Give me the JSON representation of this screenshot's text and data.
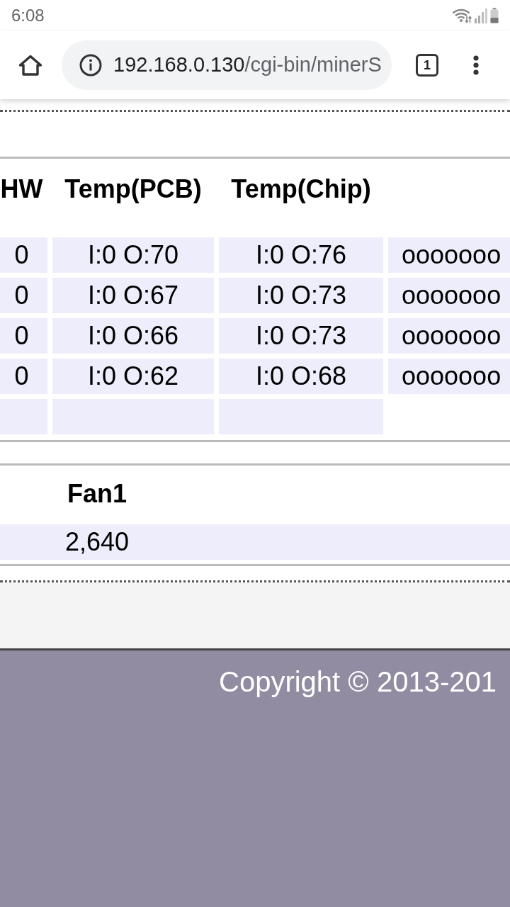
{
  "status_bar": {
    "time": "6:08"
  },
  "browser": {
    "url_host": "192.168.0.130",
    "url_path": "/cgi-bin/minerS",
    "tab_count": "1"
  },
  "stats_table": {
    "columns": [
      "HW",
      "Temp(PCB)",
      "Temp(Chip)"
    ],
    "rows": [
      {
        "kind": "data",
        "cells": [
          "0",
          "I:0 O:70",
          "I:0 O:76",
          "ooooooo"
        ]
      },
      {
        "kind": "data",
        "cells": [
          "0",
          "I:0 O:67",
          "I:0 O:73",
          "ooooooo"
        ]
      },
      {
        "kind": "data",
        "cells": [
          "0",
          "I:0 O:66",
          "I:0 O:73",
          "ooooooo"
        ]
      },
      {
        "kind": "data",
        "cells": [
          "0",
          "I:0 O:62",
          "I:0 O:68",
          "ooooooo"
        ]
      },
      {
        "kind": "blank"
      }
    ]
  },
  "fan_table": {
    "columns": [
      "Fan1"
    ],
    "rows": [
      [
        "2,640"
      ]
    ]
  },
  "footer": {
    "copyright": "Copyright © 2013-201"
  }
}
